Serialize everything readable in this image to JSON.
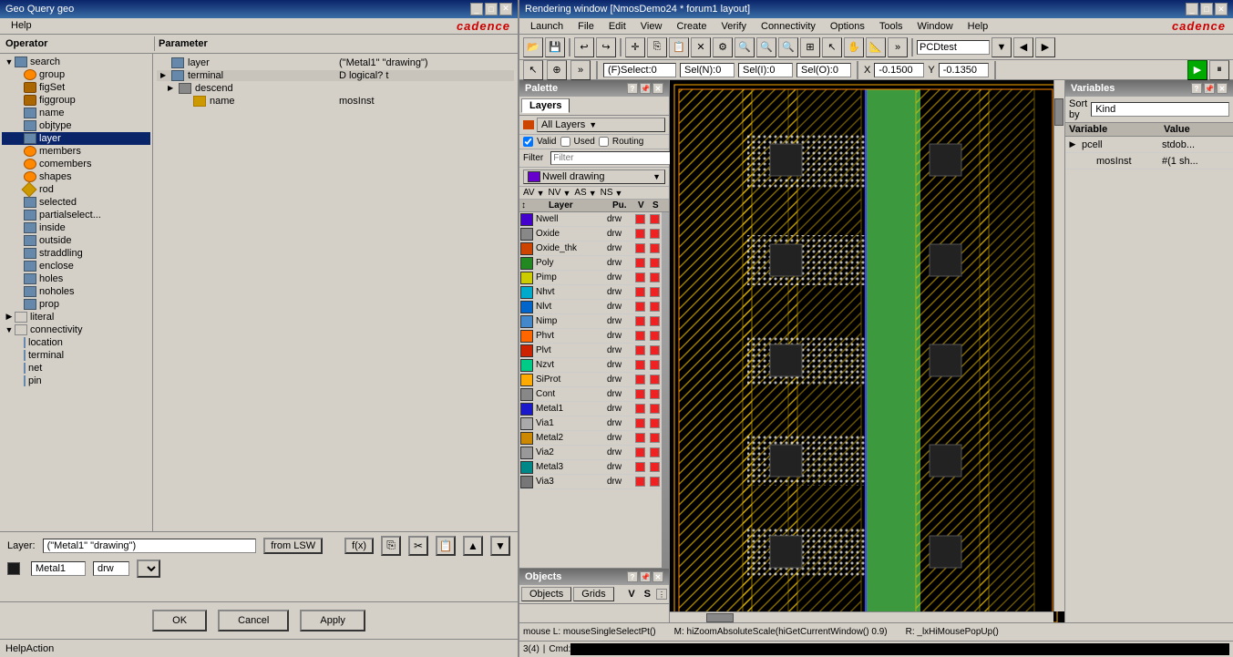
{
  "geo_query": {
    "title": "Geo Query geo",
    "help_menu": "Help",
    "cadence_logo": "cadence",
    "operator_col": "Operator",
    "parameter_col": "Parameter",
    "tree": {
      "root": "search",
      "items": [
        {
          "id": "search",
          "label": "search",
          "level": 0,
          "expandable": true,
          "icon": "folder"
        },
        {
          "id": "group",
          "label": "group",
          "level": 1,
          "expandable": false,
          "icon": "orange"
        },
        {
          "id": "figSet",
          "label": "figSet",
          "level": 1,
          "expandable": false,
          "icon": "blue"
        },
        {
          "id": "figgroup",
          "label": "figgroup",
          "level": 1,
          "expandable": false,
          "icon": "folder"
        },
        {
          "id": "name",
          "label": "name",
          "level": 1,
          "expandable": false,
          "icon": "blue"
        },
        {
          "id": "objtype",
          "label": "objtype",
          "level": 1,
          "expandable": false,
          "icon": "blue"
        },
        {
          "id": "layer",
          "label": "layer",
          "level": 1,
          "expandable": false,
          "icon": "blue",
          "selected": true
        },
        {
          "id": "members",
          "label": "members",
          "level": 1,
          "expandable": false,
          "icon": "orange"
        },
        {
          "id": "comembers",
          "label": "comembers",
          "level": 1,
          "expandable": false,
          "icon": "orange"
        },
        {
          "id": "shapes",
          "label": "shapes",
          "level": 1,
          "expandable": false,
          "icon": "orange"
        },
        {
          "id": "rod",
          "label": "rod",
          "level": 1,
          "expandable": false,
          "icon": "diamond"
        },
        {
          "id": "selected",
          "label": "selected",
          "level": 1,
          "expandable": false,
          "icon": "blue"
        },
        {
          "id": "partialselect",
          "label": "partialselect...",
          "level": 1,
          "expandable": false,
          "icon": "blue"
        },
        {
          "id": "inside",
          "label": "inside",
          "level": 1,
          "expandable": false,
          "icon": "blue"
        },
        {
          "id": "outside",
          "label": "outside",
          "level": 1,
          "expandable": false,
          "icon": "blue"
        },
        {
          "id": "straddling",
          "label": "straddling",
          "level": 1,
          "expandable": false,
          "icon": "blue"
        },
        {
          "id": "enclose",
          "label": "enclose",
          "level": 1,
          "expandable": false,
          "icon": "blue"
        },
        {
          "id": "holes",
          "label": "holes",
          "level": 1,
          "expandable": false,
          "icon": "blue"
        },
        {
          "id": "noholes",
          "label": "noholes",
          "level": 1,
          "expandable": false,
          "icon": "blue"
        },
        {
          "id": "prop",
          "label": "prop",
          "level": 1,
          "expandable": false,
          "icon": "blue"
        },
        {
          "id": "literal",
          "label": "literal",
          "level": 0,
          "expandable": true,
          "icon": "collapse"
        },
        {
          "id": "connectivity",
          "label": "connectivity",
          "level": 0,
          "expandable": true,
          "icon": "expand"
        },
        {
          "id": "location",
          "label": "location",
          "level": 1,
          "expandable": false,
          "icon": "line",
          "parent": "connectivity"
        },
        {
          "id": "terminal",
          "label": "terminal",
          "level": 1,
          "expandable": false,
          "icon": "line",
          "parent": "connectivity"
        },
        {
          "id": "net",
          "label": "net",
          "level": 1,
          "expandable": false,
          "icon": "line",
          "parent": "connectivity"
        },
        {
          "id": "pin",
          "label": "pin",
          "level": 1,
          "expandable": false,
          "icon": "line",
          "parent": "connectivity"
        }
      ]
    },
    "op_panel": {
      "layer_node": "layer",
      "layer_param": "(\"Metal1\" \"drawing\")",
      "terminal_node": "terminal",
      "terminal_param": "D logical? t",
      "descend_node": "descend",
      "descend_param": "",
      "name_node": "name",
      "name_param": "mosInst"
    },
    "layer_field": {
      "label": "Layer:",
      "value": "(\"Metal1\" \"drawing\")",
      "from_lsw": "from LSW",
      "fx": "f(x)",
      "layer_name": "Metal1",
      "layer_type": "drw"
    },
    "buttons": {
      "ok": "OK",
      "cancel": "Cancel",
      "apply": "Apply"
    },
    "status": "HelpAction"
  },
  "rendering_window": {
    "title": "Rendering window [NmosDemo24 * forum1 layout]",
    "cadence_logo": "cadence",
    "menus": [
      "Launch",
      "File",
      "Edit",
      "View",
      "Create",
      "Verify",
      "Connectivity",
      "Options",
      "Tools",
      "Window",
      "Help"
    ],
    "toolbar_field": "PCDtest",
    "status_bar": {
      "fselect": "(F)Select:0",
      "sel_n": "Sel(N):0",
      "sel_i": "Sel(I):0",
      "sel_o": "Sel(O):0",
      "x_label": "X",
      "x_val": "-0.1500",
      "y_label": "Y",
      "y_val": "-0.1350"
    },
    "bottom_status": {
      "mouse": "mouse L: mouseSingleSelectPt()",
      "m_key": "M: hiZoomAbsoluteScale(hiGetCurrentWindow() 0.9)",
      "r_key": "R: _lxHiMousePopUp()",
      "num": "3(4)",
      "cmd_label": "Cmd:"
    }
  },
  "palette": {
    "title": "Palette",
    "layers_tab": "Layers",
    "all_layers": "All Layers",
    "filter_checkboxes": {
      "valid": "Valid",
      "used": "Used",
      "routing": "Routing"
    },
    "filter_placeholder": "Filter",
    "nwell_drawing": "Nwell drawing",
    "col_headers": {
      "layer": "Layer",
      "pu": "Pu.",
      "v": "V",
      "s": "S"
    },
    "av_row": {
      "av": "AV",
      "nv": "NV",
      "as": "AS",
      "ns": "NS"
    },
    "layers": [
      {
        "name": "Nwell",
        "type": "drw",
        "v": true,
        "s": true,
        "color": "#4400cc"
      },
      {
        "name": "Oxide",
        "type": "drw",
        "v": true,
        "s": true,
        "color": "#888888"
      },
      {
        "name": "Oxide_thk",
        "type": "drw",
        "v": true,
        "s": true,
        "color": "#cc4400"
      },
      {
        "name": "Poly",
        "type": "drw",
        "v": true,
        "s": true,
        "color": "#228822"
      },
      {
        "name": "Pimp",
        "type": "drw",
        "v": true,
        "s": true,
        "color": "#cccc00"
      },
      {
        "name": "Nhvt",
        "type": "drw",
        "v": true,
        "s": true,
        "color": "#00aacc"
      },
      {
        "name": "Nlvt",
        "type": "drw",
        "v": true,
        "s": true,
        "color": "#0066cc"
      },
      {
        "name": "Nimp",
        "type": "drw",
        "v": true,
        "s": true,
        "color": "#4488cc"
      },
      {
        "name": "Phvt",
        "type": "drw",
        "v": true,
        "s": true,
        "color": "#ff6600"
      },
      {
        "name": "Plvt",
        "type": "drw",
        "v": true,
        "s": true,
        "color": "#cc2200"
      },
      {
        "name": "Nzvt",
        "type": "drw",
        "v": true,
        "s": true,
        "color": "#00cc88"
      },
      {
        "name": "SiProt",
        "type": "drw",
        "v": true,
        "s": true,
        "color": "#ffaa00"
      },
      {
        "name": "Cont",
        "type": "drw",
        "v": true,
        "s": true,
        "color": "#888888"
      },
      {
        "name": "Metal1",
        "type": "drw",
        "v": true,
        "s": true,
        "color": "#1a1acc"
      },
      {
        "name": "Via1",
        "type": "drw",
        "v": true,
        "s": true,
        "color": "#aaaaaa"
      },
      {
        "name": "Metal2",
        "type": "drw",
        "v": true,
        "s": true,
        "color": "#cc8800"
      },
      {
        "name": "Via2",
        "type": "drw",
        "v": true,
        "s": true,
        "color": "#999999"
      },
      {
        "name": "Metal3",
        "type": "drw",
        "v": true,
        "s": true,
        "color": "#008888"
      },
      {
        "name": "Via3",
        "type": "drw",
        "v": true,
        "s": true,
        "color": "#777777"
      }
    ]
  },
  "objects_panel": {
    "title": "Objects",
    "tabs": [
      "Objects",
      "Grids"
    ],
    "col_v": "V",
    "col_s": "S"
  },
  "variables": {
    "title": "Variables",
    "sort_label": "Sort by",
    "sort_value": "Kind",
    "col_variable": "Variable",
    "col_value": "Value",
    "items": [
      {
        "name": "pcell",
        "value": "stdob...",
        "level": 1
      },
      {
        "name": "mosInst",
        "value": "#(1 sh...",
        "level": 1
      }
    ]
  }
}
